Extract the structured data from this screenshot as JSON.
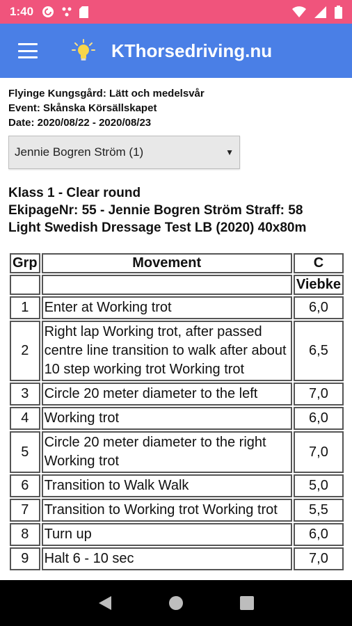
{
  "status_bar": {
    "time": "1:40",
    "icons": [
      "pocket-casts-icon",
      "notification-dots-icon",
      "sd-card-icon",
      "wifi-icon",
      "signal-icon",
      "battery-icon"
    ]
  },
  "app_bar": {
    "title": "KThorsedriving.nu",
    "logo_icon": "lightbulb-icon",
    "menu_icon": "hamburger-menu-icon"
  },
  "event": {
    "place": "Flyinge Kungsgård: Lätt och medelsvår",
    "event": "Event: Skånska Körsällskapet",
    "date": "Date: 2020/08/22 - 2020/08/23"
  },
  "rider_select": {
    "selected": "Jennie Bogren Ström (1)"
  },
  "class_info": {
    "klass": "Klass 1 - Clear round",
    "ekipage": "EkipageNr: 55 - Jennie Bogren Ström Straff: 58",
    "test": "Light Swedish Dressage Test LB (2020) 40x80m"
  },
  "table": {
    "headers": {
      "grp": "Grp",
      "movement": "Movement",
      "judge": "C"
    },
    "judge_name": "Viebke",
    "rows": [
      {
        "grp": "1",
        "movement": "Enter at Working trot",
        "score": "6,0"
      },
      {
        "grp": "2",
        "movement": "Right lap Working trot, after passed centre line transition to walk after about 10 step working trot Working trot",
        "score": "6,5"
      },
      {
        "grp": "3",
        "movement": "Circle 20 meter diameter to the left",
        "score": "7,0"
      },
      {
        "grp": "4",
        "movement": "Working trot",
        "score": "6,0"
      },
      {
        "grp": "5",
        "movement": "Circle 20 meter diameter to the right Working trot",
        "score": "7,0"
      },
      {
        "grp": "6",
        "movement": "Transition to Walk Walk",
        "score": "5,0"
      },
      {
        "grp": "7",
        "movement": "Transition to Working trot Working trot",
        "score": "5,5"
      },
      {
        "grp": "8",
        "movement": "Turn up",
        "score": "6,0"
      },
      {
        "grp": "9",
        "movement": "Halt 6 - 10 sec",
        "score": "7,0"
      }
    ]
  },
  "nav_bar": {
    "icons": [
      "back-icon",
      "home-icon",
      "recents-icon"
    ]
  },
  "colors": {
    "status_bar": "#f0547c",
    "app_bar": "#4a7fe6"
  }
}
